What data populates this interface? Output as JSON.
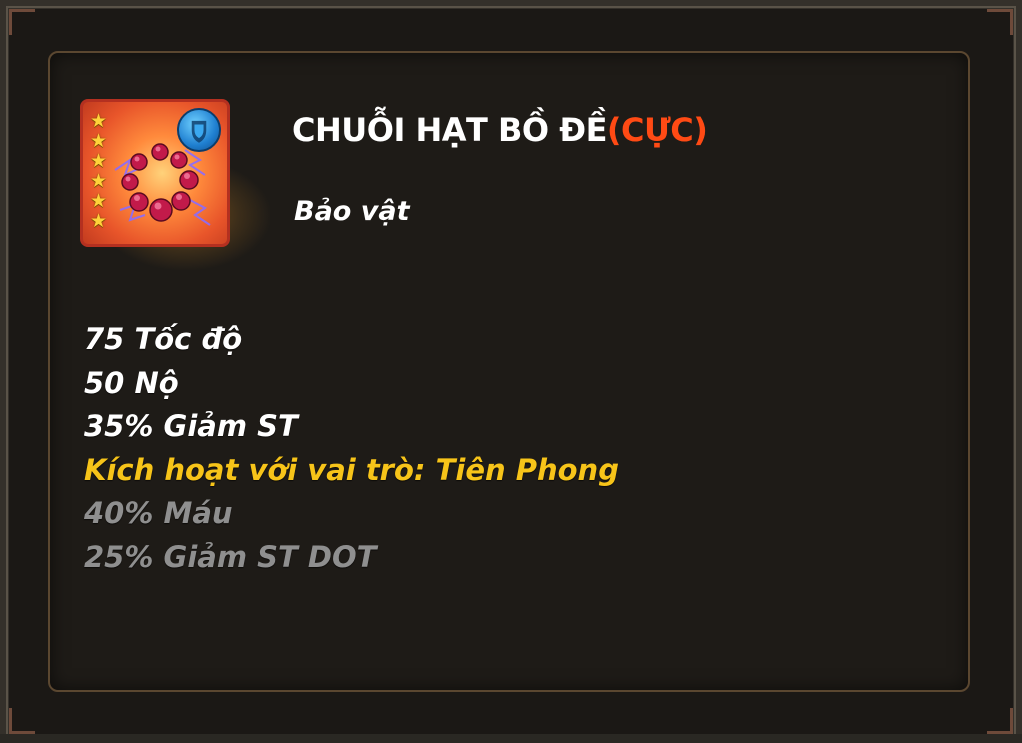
{
  "item": {
    "name": "CHUỖI HẠT BỒ ĐỀ",
    "grade": "(CỰC)",
    "type": "Bảo vật",
    "star_count": 6,
    "role_icon": "vanguard-role-icon",
    "icon": "prayer-beads-icon"
  },
  "stats": {
    "speed": "75 Tốc độ",
    "rage": "50 Nộ",
    "damage_reduction": "35% Giảm ST"
  },
  "activation": {
    "label": "Kích hoạt với vai trò: Tiên Phong",
    "bonus_hp": "40% Máu",
    "bonus_dot_reduction": "25% Giảm ST DOT"
  },
  "colors": {
    "grade": "#ff4a14",
    "activation": "#f7c419",
    "inactive": "#8f8f8f",
    "panel_border": "#5b4730"
  }
}
